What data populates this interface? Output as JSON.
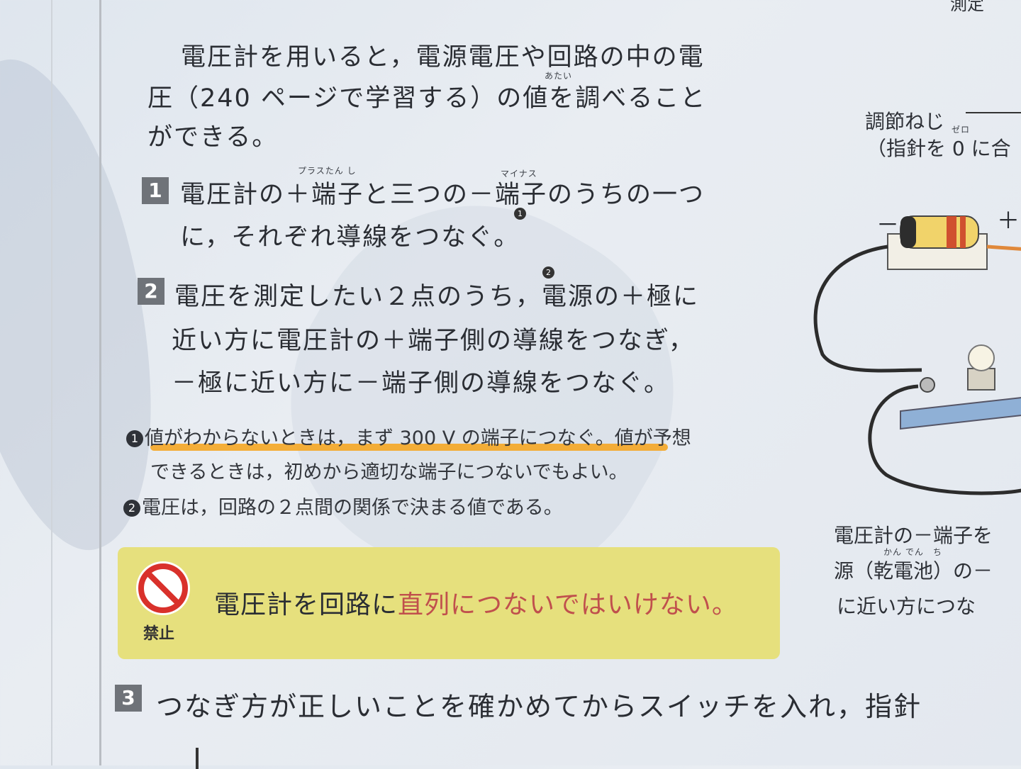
{
  "intro": {
    "line1": "電圧計を用いると，電源電圧や回路の中の電",
    "line2": "圧（240 ページで学習する）の値を調べること",
    "line3": "ができる。",
    "ruby_atai": "あたい"
  },
  "steps": [
    {
      "num": "1",
      "line1": "電圧計の＋端子と三つの－端子のうちの一つ",
      "line2": "に，それぞれ導線をつなぐ。",
      "ruby_plus_tanshi": "プラスたん し",
      "ruby_minus": "マイナス",
      "note_ref": "1"
    },
    {
      "num": "2",
      "line1": "電圧を測定したい２点のうち，電源の＋極に",
      "line2": "近い方に電圧計の＋端子側の導線をつなぎ，",
      "line3": "－極に近い方に－端子側の導線をつなぐ。",
      "note_ref": "2"
    },
    {
      "num": "3",
      "line1": "つなぎ方が正しいことを確かめてからスイッチを入れ，指針"
    }
  ],
  "notes": [
    {
      "num": "1",
      "line1": "値がわからないときは，まず 300 V の端子につなぐ。値が予想",
      "line2": "できるときは，初めから適切な端子につないでもよい。"
    },
    {
      "num": "2",
      "line1": "電圧は，回路の２点間の関係で決まる値である。"
    }
  ],
  "warning": {
    "label": "禁止",
    "text_before": "電圧計を回路に",
    "text_highlight": "直列につないではいけない。"
  },
  "sidebar": {
    "top_fragment": "測定",
    "adjust_line1": "調節ねじ",
    "adjust_line2": "（指針を 0 に合",
    "ruby_zero": "ゼロ",
    "minus_sign": "－",
    "plus_sign": "＋",
    "caption_line1": "電圧計の－端子を",
    "caption_line2": "源（乾電池）の－",
    "caption_line3": "に近い方につな",
    "ruby_kandenchi": "かん でん　ち"
  },
  "colors": {
    "underline": "#f5a623",
    "warning_bg": "#e6e07d",
    "highlight_text": "#c0504d",
    "prohibit_red": "#d9312b"
  }
}
